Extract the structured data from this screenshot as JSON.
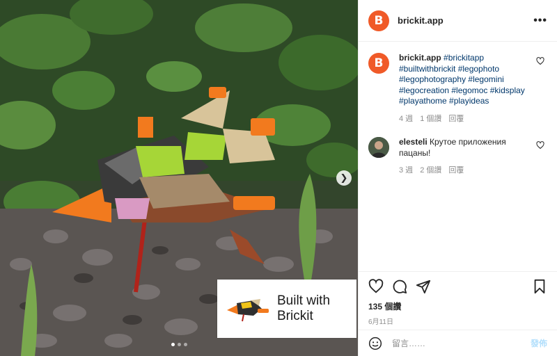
{
  "post": {
    "username": "brickit.app",
    "avatar_letter": "B",
    "caption_tags": "#brickitapp #builtwithbrickit #legophoto #legophotography #legomini #legocreation #legomoc #kidsplay #playathome #playideas",
    "caption_time": "4 週",
    "caption_likes": "1 個讚",
    "caption_reply": "回覆",
    "likes": "135 個讚",
    "date": "6月11日",
    "add_comment_placeholder": "留言……",
    "post_label": "發佈"
  },
  "comments": [
    {
      "author": "elesteli",
      "text": "Крутое приложения пацаны!",
      "time": "3 週",
      "likes": "2 個讚",
      "reply": "回覆"
    }
  ],
  "overlay": {
    "line1": "Built with",
    "line2": "Brickit"
  },
  "carousel": {
    "slides": 3,
    "active": 1
  },
  "colors": {
    "brand": "#f05a28",
    "text": "#262626",
    "muted": "#8e8e8e",
    "hashtag": "#00376b",
    "post_button": "#b2dffc"
  },
  "icons": [
    "more-icon",
    "heart-icon",
    "comment-icon",
    "share-icon",
    "save-icon",
    "emoji-icon",
    "next-arrow-icon"
  ]
}
